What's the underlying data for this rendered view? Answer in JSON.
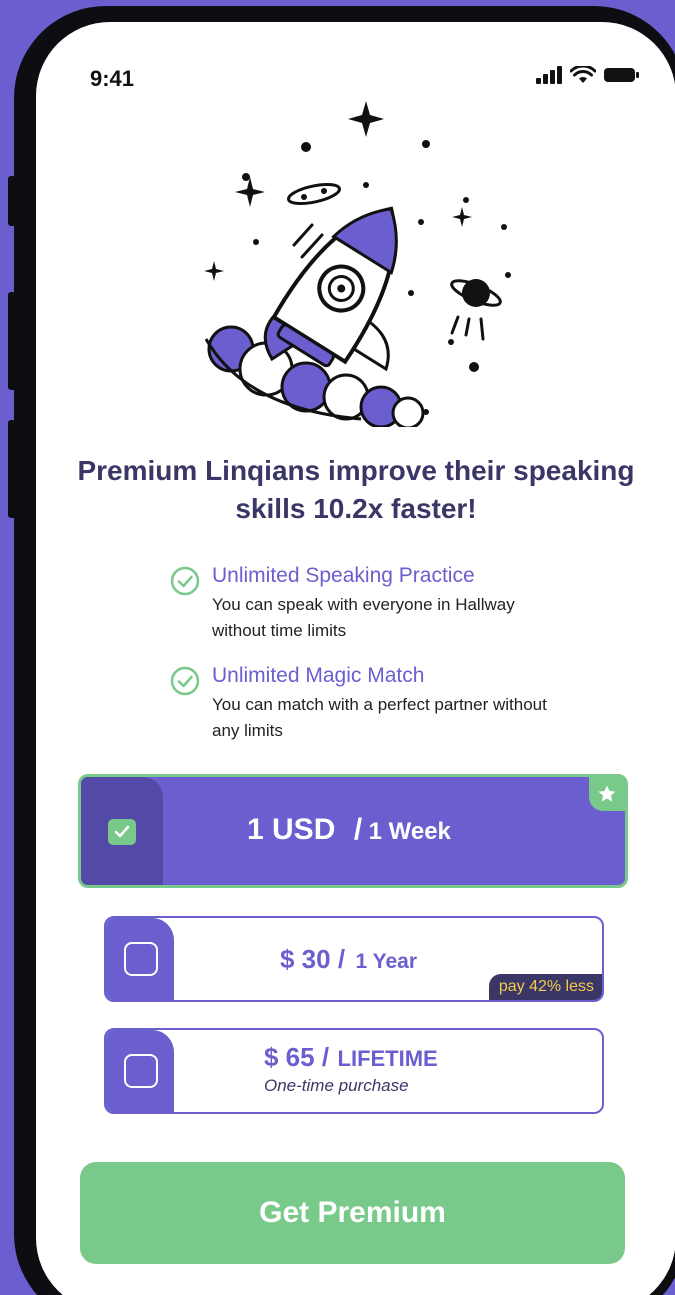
{
  "status_bar": {
    "time": "9:41"
  },
  "headline": "Premium Linqians improve their speaking skills 10.2x faster!",
  "features": [
    {
      "title": "Unlimited Speaking Practice",
      "desc": "You can speak with everyone in Hallway without time limits"
    },
    {
      "title": "Unlimited Magic Match",
      "desc": "You can match with a perfect partner without any limits"
    }
  ],
  "plans": {
    "weekly": {
      "price": "1 USD",
      "sep": "/",
      "period": "1 Week",
      "selected": true
    },
    "yearly": {
      "price": "$ 30 /",
      "period": "1 Year",
      "badge": "pay 42% less"
    },
    "lifetime": {
      "price": "$ 65 /",
      "period": "LIFETIME",
      "sub": "One-time purchase"
    }
  },
  "cta_label": "Get Premium",
  "colors": {
    "brand_purple": "#6b5fd0",
    "dark_purple": "#534aa8",
    "green": "#79c98a",
    "badge_bg": "#3a3666",
    "badge_text": "#f2c94c"
  }
}
